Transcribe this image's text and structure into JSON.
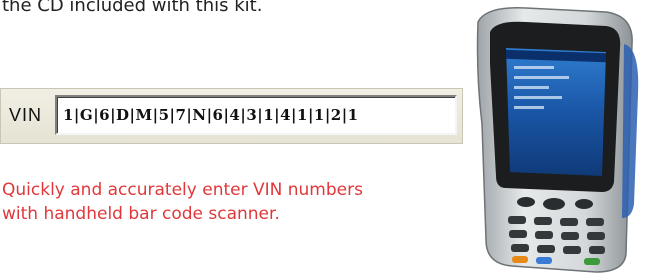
{
  "intro": {
    "text": "the CD included with this kit."
  },
  "vin": {
    "label": "VIN",
    "value": "1|G|6|D|M|5|7|N|6|4|3|1|4|1|1|2|1"
  },
  "caption": {
    "line1": "Quickly and accurately enter VIN numbers",
    "line2": "with handheld bar code scanner."
  },
  "colors": {
    "caption": "#e0383a",
    "panel": "#ece9dc",
    "device_body": "#cfd3d6",
    "device_screen": "#1d5aa8"
  },
  "icons": {
    "device": "handheld-scanner-image"
  }
}
